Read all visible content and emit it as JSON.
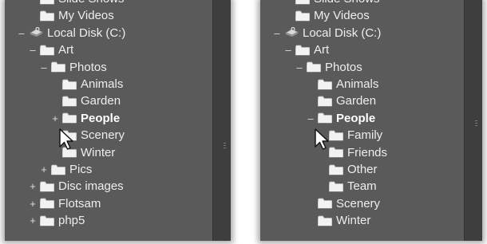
{
  "left_tree": {
    "items": [
      {
        "expander": "",
        "label": "Slide Shows",
        "icon": "folder-icon"
      },
      {
        "expander": "",
        "label": "My Videos",
        "icon": "folder-icon"
      },
      {
        "expander": "–",
        "label": "Local Disk (C:)",
        "icon": "disk-icon"
      },
      {
        "expander": "–",
        "label": "Art",
        "icon": "folder-icon"
      },
      {
        "expander": "–",
        "label": "Photos",
        "icon": "folder-icon"
      },
      {
        "expander": "",
        "label": "Animals",
        "icon": "folder-icon"
      },
      {
        "expander": "",
        "label": "Garden",
        "icon": "folder-icon"
      },
      {
        "expander": "+",
        "label": "People",
        "icon": "folder-icon",
        "bold": true
      },
      {
        "expander": "",
        "label": "Scenery",
        "icon": "folder-icon"
      },
      {
        "expander": "",
        "label": "Winter",
        "icon": "folder-icon"
      },
      {
        "expander": "+",
        "label": "Pics",
        "icon": "folder-icon"
      },
      {
        "expander": "+",
        "label": "Disc images",
        "icon": "folder-icon"
      },
      {
        "expander": "+",
        "label": "Flotsam",
        "icon": "folder-icon"
      },
      {
        "expander": "+",
        "label": "php5",
        "icon": "folder-icon"
      }
    ]
  },
  "right_tree": {
    "items": [
      {
        "expander": "",
        "label": "Slide Shows",
        "icon": "folder-icon"
      },
      {
        "expander": "",
        "label": "My Videos",
        "icon": "folder-icon"
      },
      {
        "expander": "–",
        "label": "Local Disk (C:)",
        "icon": "disk-icon"
      },
      {
        "expander": "–",
        "label": "Art",
        "icon": "folder-icon"
      },
      {
        "expander": "–",
        "label": "Photos",
        "icon": "folder-icon"
      },
      {
        "expander": "",
        "label": "Animals",
        "icon": "folder-icon"
      },
      {
        "expander": "",
        "label": "Garden",
        "icon": "folder-icon"
      },
      {
        "expander": "–",
        "label": "People",
        "icon": "folder-icon",
        "bold": true
      },
      {
        "expander": "",
        "label": "Family",
        "icon": "folder-icon"
      },
      {
        "expander": "",
        "label": "Friends",
        "icon": "folder-icon"
      },
      {
        "expander": "",
        "label": "Other",
        "icon": "folder-icon"
      },
      {
        "expander": "",
        "label": "Team",
        "icon": "folder-icon"
      },
      {
        "expander": "",
        "label": "Scenery",
        "icon": "folder-icon"
      },
      {
        "expander": "",
        "label": "Winter",
        "icon": "folder-icon"
      }
    ]
  },
  "colors": {
    "panel_bg": "#5a5a5a",
    "text": "#eeeeee",
    "folder": "#f2f2f2"
  }
}
